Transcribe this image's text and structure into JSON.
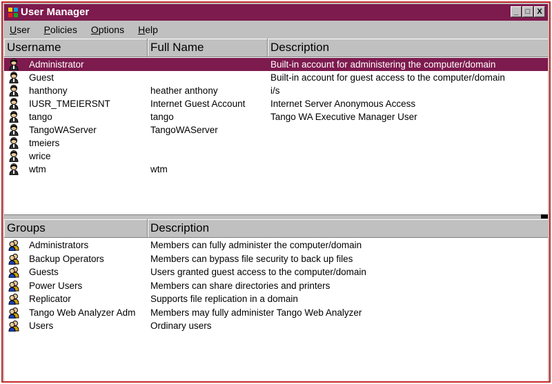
{
  "window": {
    "title": "User Manager"
  },
  "title_buttons": [
    "_",
    "□",
    "X"
  ],
  "menu": [
    {
      "accel": "U",
      "rest": "ser"
    },
    {
      "accel": "P",
      "rest": "olicies"
    },
    {
      "accel": "O",
      "rest": "ptions"
    },
    {
      "accel": "H",
      "rest": "elp"
    }
  ],
  "users": {
    "headers": {
      "username": "Username",
      "fullname": "Full Name",
      "description": "Description"
    },
    "rows": [
      {
        "username": "Administrator",
        "fullname": "",
        "description": "Built-in account for administering the computer/domain",
        "selected": true
      },
      {
        "username": "Guest",
        "fullname": "",
        "description": "Built-in account for guest access to the computer/domain"
      },
      {
        "username": "hanthony",
        "fullname": "heather anthony",
        "description": "i/s"
      },
      {
        "username": "IUSR_TMEIERSNT",
        "fullname": "Internet Guest Account",
        "description": "Internet Server Anonymous Access"
      },
      {
        "username": "tango",
        "fullname": "tango",
        "description": "Tango WA Executive Manager User"
      },
      {
        "username": "TangoWAServer",
        "fullname": "TangoWAServer",
        "description": ""
      },
      {
        "username": "tmeiers",
        "fullname": "",
        "description": ""
      },
      {
        "username": "wrice",
        "fullname": "",
        "description": ""
      },
      {
        "username": "wtm",
        "fullname": "wtm",
        "description": ""
      }
    ]
  },
  "groups": {
    "headers": {
      "group": "Groups",
      "description": "Description"
    },
    "rows": [
      {
        "name": "Administrators",
        "description": "Members can fully administer the computer/domain"
      },
      {
        "name": "Backup Operators",
        "description": "Members can bypass file security to back up files"
      },
      {
        "name": "Guests",
        "description": "Users granted guest access to the computer/domain"
      },
      {
        "name": "Power Users",
        "description": "Members can share directories and printers"
      },
      {
        "name": "Replicator",
        "description": "Supports file replication in a domain"
      },
      {
        "name": "Tango Web Analyzer Adm",
        "description": "Members may fully administer Tango Web Analyzer"
      },
      {
        "name": "Users",
        "description": "Ordinary users"
      }
    ]
  },
  "icons": {
    "user": "user-icon",
    "group": "group-icon",
    "app": "user-manager-app-icon"
  },
  "colors": {
    "selection": "#7d1a4e",
    "titlebar": "#7d1a4e",
    "frame": "#c62828"
  }
}
